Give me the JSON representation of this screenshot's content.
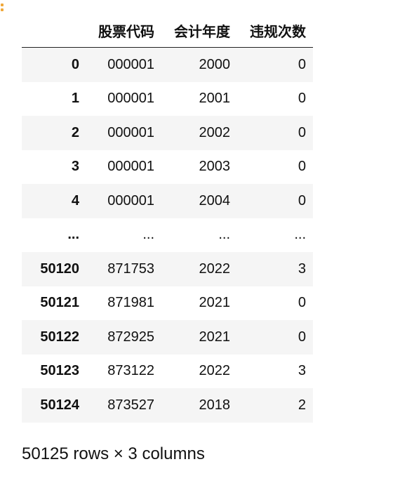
{
  "dataframe": {
    "columns": [
      "股票代码",
      "会计年度",
      "违规次数"
    ],
    "rows": [
      {
        "index": "0",
        "cells": [
          "000001",
          "2000",
          "0"
        ]
      },
      {
        "index": "1",
        "cells": [
          "000001",
          "2001",
          "0"
        ]
      },
      {
        "index": "2",
        "cells": [
          "000001",
          "2002",
          "0"
        ]
      },
      {
        "index": "3",
        "cells": [
          "000001",
          "2003",
          "0"
        ]
      },
      {
        "index": "4",
        "cells": [
          "000001",
          "2004",
          "0"
        ]
      },
      {
        "index": "...",
        "cells": [
          "...",
          "...",
          "..."
        ]
      },
      {
        "index": "50120",
        "cells": [
          "871753",
          "2022",
          "3"
        ]
      },
      {
        "index": "50121",
        "cells": [
          "871981",
          "2021",
          "0"
        ]
      },
      {
        "index": "50122",
        "cells": [
          "872925",
          "2021",
          "0"
        ]
      },
      {
        "index": "50123",
        "cells": [
          "873122",
          "2022",
          "3"
        ]
      },
      {
        "index": "50124",
        "cells": [
          "873527",
          "2018",
          "2"
        ]
      }
    ],
    "shape_caption": "50125 rows × 3 columns"
  },
  "colors": {
    "row_stripe": "#f5f5f5",
    "header_rule": "#222222",
    "output_marker": "#f0a83a"
  }
}
